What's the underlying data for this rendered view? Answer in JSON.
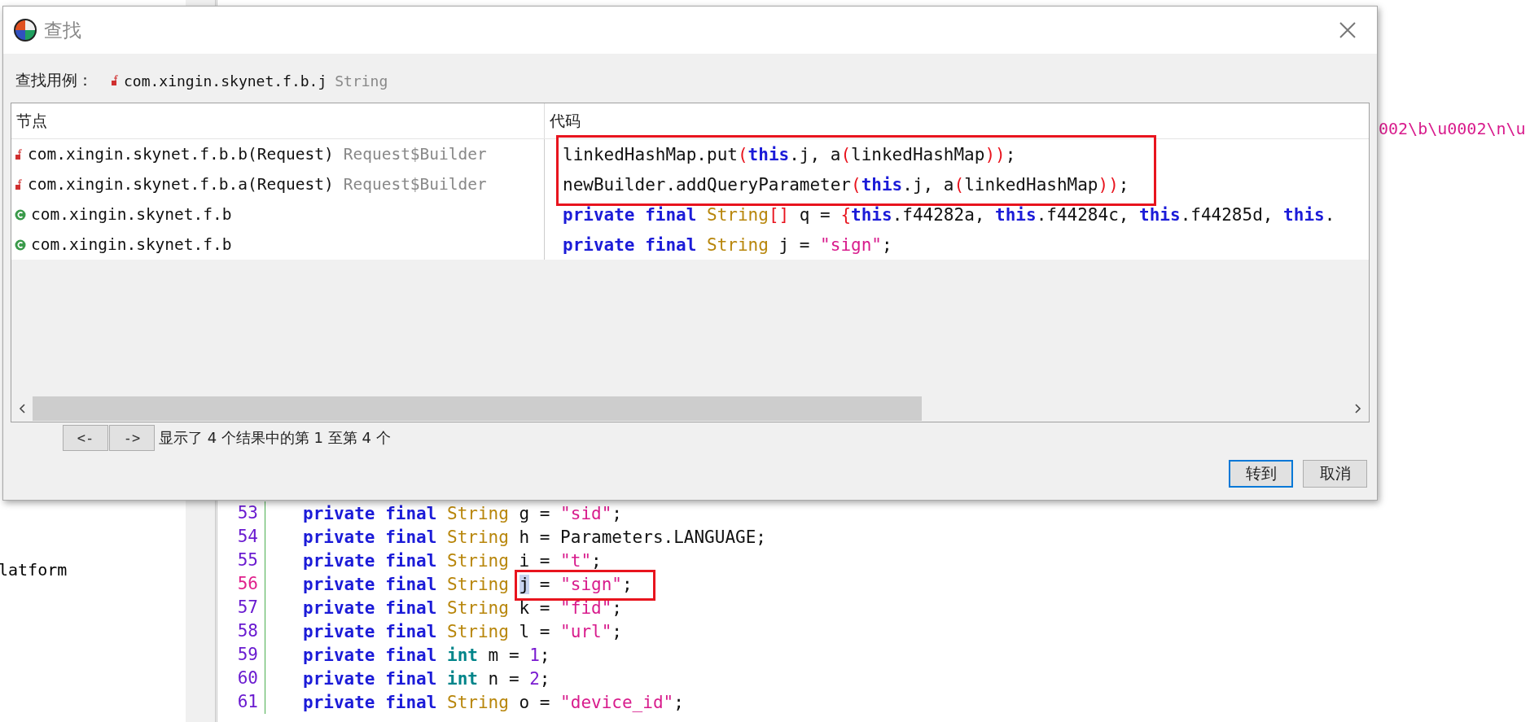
{
  "background_editor": {
    "sidebar_text": "latform",
    "right_text": "002\\b\\u0002\\n\\u",
    "lines": [
      {
        "number": "53",
        "current": false,
        "tokens": [
          {
            "kind": "kw",
            "t": "private final "
          },
          {
            "kind": "ty",
            "t": "String"
          },
          {
            "kind": "p",
            "t": " g = "
          },
          {
            "kind": "str",
            "t": "\"sid\""
          },
          {
            "kind": "p",
            "t": ";"
          }
        ]
      },
      {
        "number": "54",
        "current": false,
        "tokens": [
          {
            "kind": "kw",
            "t": "private final "
          },
          {
            "kind": "ty",
            "t": "String"
          },
          {
            "kind": "p",
            "t": " h = Parameters.LANGUAGE;"
          }
        ]
      },
      {
        "number": "55",
        "current": false,
        "tokens": [
          {
            "kind": "kw",
            "t": "private final "
          },
          {
            "kind": "ty",
            "t": "String"
          },
          {
            "kind": "p",
            "t": " i = "
          },
          {
            "kind": "str",
            "t": "\"t\""
          },
          {
            "kind": "p",
            "t": ";"
          }
        ]
      },
      {
        "number": "56",
        "current": true,
        "tokens": [
          {
            "kind": "kw",
            "t": "private final "
          },
          {
            "kind": "ty",
            "t": "String "
          },
          {
            "kind": "sel",
            "t": "j"
          },
          {
            "kind": "p",
            "t": " = "
          },
          {
            "kind": "str",
            "t": "\"sign\""
          },
          {
            "kind": "p",
            "t": ";"
          }
        ]
      },
      {
        "number": "57",
        "current": false,
        "tokens": [
          {
            "kind": "kw",
            "t": "private final "
          },
          {
            "kind": "ty",
            "t": "String"
          },
          {
            "kind": "p",
            "t": " k = "
          },
          {
            "kind": "str",
            "t": "\"fid\""
          },
          {
            "kind": "p",
            "t": ";"
          }
        ]
      },
      {
        "number": "58",
        "current": false,
        "tokens": [
          {
            "kind": "kw",
            "t": "private final "
          },
          {
            "kind": "ty",
            "t": "String"
          },
          {
            "kind": "p",
            "t": " l = "
          },
          {
            "kind": "str",
            "t": "\"url\""
          },
          {
            "kind": "p",
            "t": ";"
          }
        ]
      },
      {
        "number": "59",
        "current": false,
        "tokens": [
          {
            "kind": "kw",
            "t": "private final "
          },
          {
            "kind": "prim",
            "t": "int"
          },
          {
            "kind": "p",
            "t": " m = "
          },
          {
            "kind": "num",
            "t": "1"
          },
          {
            "kind": "p",
            "t": ";"
          }
        ]
      },
      {
        "number": "60",
        "current": false,
        "tokens": [
          {
            "kind": "kw",
            "t": "private final "
          },
          {
            "kind": "prim",
            "t": "int"
          },
          {
            "kind": "p",
            "t": " n = "
          },
          {
            "kind": "num",
            "t": "2"
          },
          {
            "kind": "p",
            "t": ";"
          }
        ]
      },
      {
        "number": "61",
        "current": false,
        "tokens": [
          {
            "kind": "kw",
            "t": "private final "
          },
          {
            "kind": "ty",
            "t": "String"
          },
          {
            "kind": "p",
            "t": " o = "
          },
          {
            "kind": "str",
            "t": "\"device_id\""
          },
          {
            "kind": "p",
            "t": ";"
          }
        ]
      }
    ]
  },
  "dialog": {
    "title": "查找",
    "find_usage_label": "查找用例：",
    "target": {
      "name": "com.xingin.skynet.f.b.j",
      "type": "String"
    },
    "columns": [
      "节点",
      "代码"
    ],
    "rows": [
      {
        "kind": "method",
        "node": "com.xingin.skynet.f.b.b(Request)",
        "node_type": "Request$Builder",
        "code": [
          {
            "kind": "p",
            "t": "linkedHashMap.put"
          },
          {
            "kind": "red",
            "t": "("
          },
          {
            "kind": "kw",
            "t": "this"
          },
          {
            "kind": "p",
            "t": ".j, a"
          },
          {
            "kind": "red",
            "t": "("
          },
          {
            "kind": "p",
            "t": "linkedHashMap"
          },
          {
            "kind": "red",
            "t": "))"
          },
          {
            "kind": "p",
            "t": ";"
          }
        ]
      },
      {
        "kind": "method",
        "node": "com.xingin.skynet.f.b.a(Request)",
        "node_type": "Request$Builder",
        "code": [
          {
            "kind": "p",
            "t": "newBuilder.addQueryParameter"
          },
          {
            "kind": "red",
            "t": "("
          },
          {
            "kind": "kw",
            "t": "this"
          },
          {
            "kind": "p",
            "t": ".j, a"
          },
          {
            "kind": "red",
            "t": "("
          },
          {
            "kind": "p",
            "t": "linkedHashMap"
          },
          {
            "kind": "red",
            "t": "))"
          },
          {
            "kind": "p",
            "t": ";"
          }
        ]
      },
      {
        "kind": "class",
        "node": "com.xingin.skynet.f.b",
        "code": [
          {
            "kind": "kw",
            "t": "private final "
          },
          {
            "kind": "ty",
            "t": "String"
          },
          {
            "kind": "red",
            "t": "[]"
          },
          {
            "kind": "p",
            "t": " q = "
          },
          {
            "kind": "red",
            "t": "{"
          },
          {
            "kind": "kw",
            "t": "this"
          },
          {
            "kind": "p",
            "t": ".f44282a, "
          },
          {
            "kind": "kw",
            "t": "this"
          },
          {
            "kind": "p",
            "t": ".f44284c, "
          },
          {
            "kind": "kw",
            "t": "this"
          },
          {
            "kind": "p",
            "t": ".f44285d, "
          },
          {
            "kind": "kw",
            "t": "this"
          },
          {
            "kind": "p",
            "t": "."
          }
        ]
      },
      {
        "kind": "class",
        "node": "com.xingin.skynet.f.b",
        "code": [
          {
            "kind": "kw",
            "t": "private final "
          },
          {
            "kind": "ty",
            "t": "String"
          },
          {
            "kind": "p",
            "t": " j = "
          },
          {
            "kind": "str",
            "t": "\"sign\""
          },
          {
            "kind": "p",
            "t": ";"
          }
        ]
      }
    ],
    "nav_buttons": [
      "<-",
      "->"
    ],
    "status": "显示了 4 个结果中的第 1 至第 4 个",
    "buttons": [
      {
        "label": "转到",
        "default": true
      },
      {
        "label": "取消",
        "default": false
      }
    ]
  }
}
